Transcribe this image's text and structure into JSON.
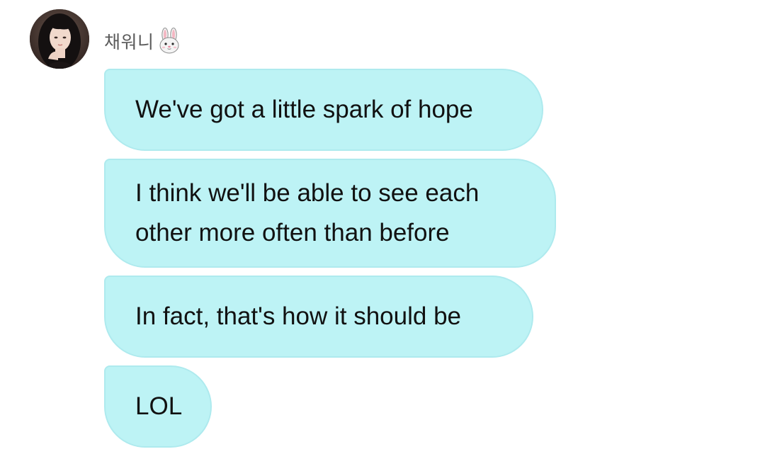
{
  "sender": {
    "name": "채워니",
    "emoji": "🐰"
  },
  "messages": [
    {
      "text": "We've got a little spark of hope"
    },
    {
      "text": "I think we'll be able to see each\nother more often than before"
    },
    {
      "text": "In fact, that's how it should be"
    },
    {
      "text": "LOL"
    }
  ],
  "colors": {
    "bubble_background": "#bdf3f5",
    "bubble_border": "#aeeaee",
    "message_text": "#111111",
    "sender_text": "#5a5a5a",
    "page_background": "#ffffff"
  }
}
